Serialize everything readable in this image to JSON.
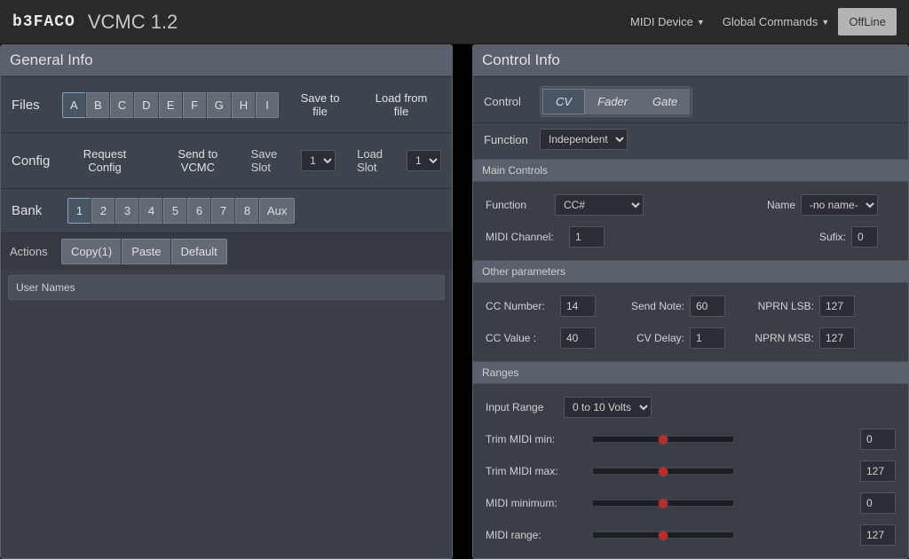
{
  "header": {
    "logo": "b3FACO",
    "title": "VCMC 1.2",
    "midi_device": "MIDI Device",
    "global_commands": "Global Commands",
    "offline": "OffLine"
  },
  "general": {
    "title": "General Info",
    "files_label": "Files",
    "file_tabs": [
      "A",
      "B",
      "C",
      "D",
      "E",
      "F",
      "G",
      "H",
      "I"
    ],
    "save_to_file": "Save to file",
    "load_from_file": "Load from file",
    "config_label": "Config",
    "request_config": "Request Config",
    "send_to_vcmc": "Send to VCMC",
    "save_slot": "Save Slot",
    "save_slot_value": "1",
    "load_slot": "Load Slot",
    "load_slot_value": "1",
    "bank_label": "Bank",
    "bank_tabs": [
      "1",
      "2",
      "3",
      "4",
      "5",
      "6",
      "7",
      "8",
      "Aux"
    ],
    "actions_label": "Actions",
    "copy": "Copy(1)",
    "paste": "Paste",
    "default": "Default",
    "user_names": "User Names"
  },
  "control": {
    "title": "Control Info",
    "control_label": "Control",
    "tabs": [
      "CV",
      "Fader",
      "Gate"
    ],
    "function_label": "Function",
    "function_value": "Independent",
    "main_controls": "Main Controls",
    "func_label": "Function",
    "func_value": "CC#",
    "name_label": "Name",
    "name_value": "-no name-",
    "midi_channel_label": "MIDI Channel:",
    "midi_channel_value": "1",
    "sufix_label": "Sufix:",
    "sufix_value": "0",
    "other_params": "Other parameters",
    "cc_number_label": "CC Number:",
    "cc_number_value": "14",
    "send_note_label": "Send Note:",
    "send_note_value": "60",
    "nprn_lsb_label": "NPRN LSB:",
    "nprn_lsb_value": "127",
    "cc_value_label": "CC Value :",
    "cc_value_value": "40",
    "cv_delay_label": "CV Delay:",
    "cv_delay_value": "1",
    "nprn_msb_label": "NPRN MSB:",
    "nprn_msb_value": "127",
    "ranges": "Ranges",
    "input_range_label": "Input Range",
    "input_range_value": "0 to 10 Volts",
    "sliders": [
      {
        "label": "Trim MIDI min:",
        "value": "0"
      },
      {
        "label": "Trim MIDI max:",
        "value": "127"
      },
      {
        "label": "MIDI minimum:",
        "value": "0"
      },
      {
        "label": "MIDI range:",
        "value": "127"
      }
    ]
  }
}
